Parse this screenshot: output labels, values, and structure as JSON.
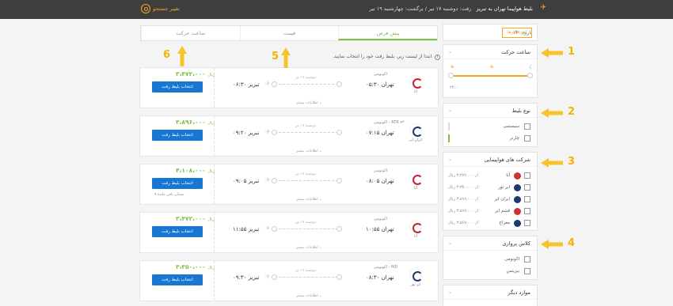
{
  "topbar": {
    "route": "بلیط هواپیما تهران به تبریز",
    "dates": "رفت: دوشنبه ۱۷ تیر  /  برگشت: چهارشنبه ۱۹ تیر",
    "change_search": "تغییر جستجو"
  },
  "sidebar": {
    "date_label": "تاریخ : ۱۴",
    "clear_filters": "لغو فیلترها",
    "departure_time": {
      "title": "ساعت حرکت",
      "range_label": "۲۴:۰۰"
    },
    "ticket_type": {
      "title": "نوع بلیط",
      "options": [
        "سیستمی",
        "چارتر"
      ]
    },
    "airlines": {
      "title": "شرکت های هواپیمایی",
      "items": [
        {
          "name": "آتا",
          "price": "از ۳،۴۷۲،۰۰۰ ریال"
        },
        {
          "name": "ایر تور",
          "price": "از ۳،۳۵۰،۰۰۰ ریال"
        },
        {
          "name": "ایران ایر",
          "price": "از ۳،۸۹۶،۰۰۰ ریال"
        },
        {
          "name": "قشم ایر",
          "price": "از ۳،۸۹۶،۰۰۰ ریال"
        },
        {
          "name": "معراج",
          "price": "از ۳،۵۶۷،۰۰۰ ریال"
        }
      ]
    },
    "cabin_class": {
      "title": "کلاس پروازی",
      "options": [
        "اکونومی",
        "بیزینس"
      ]
    },
    "other": {
      "title": "موارد دیگر"
    }
  },
  "tabs": [
    "پیش فرض",
    "قیمت",
    "ساعت حرکت"
  ],
  "hint": "ابتدا از لیست زیر، بلیط رفت خود را انتخاب نمایید.",
  "flights": [
    {
      "airline": "آتا",
      "class": "اکونومی",
      "dep": "تهران ۰۵:۳۰",
      "arr": "تبریز ۰۶:۳۰",
      "date": "دوشنبه ۱۷ تیر",
      "old": "",
      "price": "۳،۴۷۲،۰۰۰",
      "unit": "ریال",
      "btn": "انتخاب بلیط رفت",
      "more": "اطلاعات بیشتر",
      "note": ""
    },
    {
      "airline": "ایران ایر",
      "class": "ATR ۷۲ - اکونومی",
      "dep": "تهران ۰۷:۱۵",
      "arr": "تبریز ۰۹:۲۰",
      "date": "دوشنبه ۱۷ تیر",
      "old": "",
      "price": "۳،۸۹۶،۰۰۰",
      "unit": "ریال",
      "btn": "انتخاب بلیط رفت",
      "more": "اطلاعات بیشتر",
      "note": ""
    },
    {
      "airline": "آتا",
      "class": "اکونومی",
      "dep": "تهران ۰۸:۰۵",
      "arr": "تبریز ۰۹:۰۵",
      "date": "دوشنبه ۱۷ تیر",
      "old": "",
      "price": "۴،۱۰۸،۰۰۰",
      "unit": "ریال",
      "btn": "انتخاب بلیط رفت",
      "more": "اطلاعات بیشتر",
      "note": "۹ صندلی باقی مانده"
    },
    {
      "airline": "آتا",
      "class": "اکونومی",
      "dep": "تهران ۱۰:۵۵",
      "arr": "تبریز ۱۱:۵۵",
      "date": "دوشنبه ۱۷ تیر",
      "old": "",
      "price": "۳،۴۷۲،۰۰۰",
      "unit": "ریال",
      "btn": "انتخاب بلیط رفت",
      "more": "اطلاعات بیشتر",
      "note": ""
    },
    {
      "airline": "ایر تور",
      "class": "MD - اکونومی",
      "dep": "تهران ۰۸:۳۰",
      "arr": "تبریز ۰۹:۳۰",
      "date": "دوشنبه ۱۷ تیر",
      "old": "",
      "price": "۳،۳۵۰،۰۰۰",
      "unit": "ریال",
      "btn": "انتخاب بلیط رفت",
      "more": "اطلاعات بیشتر",
      "note": ""
    }
  ],
  "annotations": [
    "1",
    "2",
    "3",
    "4",
    "5",
    "6"
  ],
  "colors": {
    "accent": "#f5a623",
    "green": "#7bc043",
    "button": "#1976d2",
    "arrow": "#f7c32b"
  }
}
